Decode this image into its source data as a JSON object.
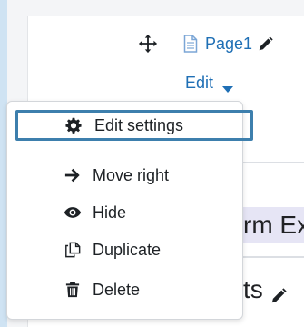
{
  "header": {
    "page_link": "Page1",
    "edit_label": "Edit"
  },
  "background": {
    "band_text": "rm Ex",
    "section_text": "ts"
  },
  "menu": {
    "items": [
      {
        "label": "Edit settings",
        "icon": "gear-icon",
        "focused": true
      },
      {
        "label": "Move right",
        "icon": "arrow-right-icon"
      },
      {
        "label": "Hide",
        "icon": "eye-icon"
      },
      {
        "label": "Duplicate",
        "icon": "duplicate-icon"
      },
      {
        "label": "Delete",
        "icon": "trash-icon"
      }
    ]
  },
  "colors": {
    "link": "#1f6fb5",
    "focus_border": "#3d7fad",
    "band": "#e6e5f5"
  }
}
